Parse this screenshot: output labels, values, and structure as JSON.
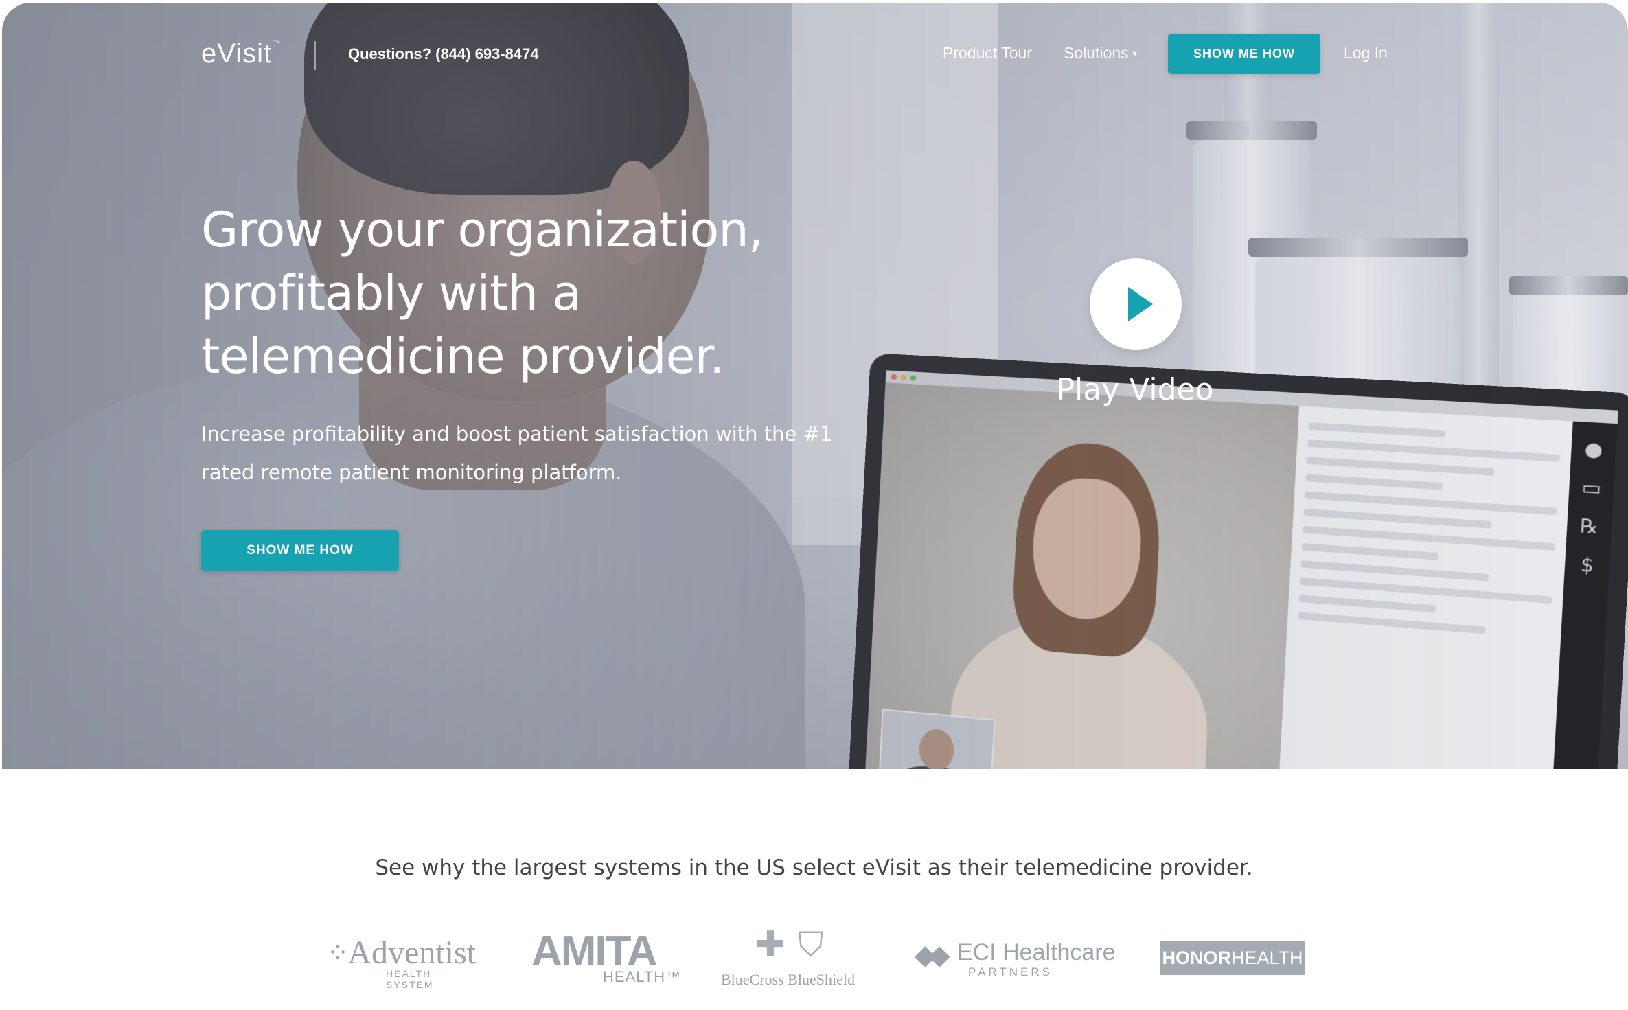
{
  "nav": {
    "logo": "eVisit",
    "logo_tm": "™",
    "phone": "Questions? (844) 693-8474",
    "links": {
      "product_tour": "Product Tour",
      "solutions": "Solutions",
      "login": "Log In"
    },
    "cta": "SHOW ME HOW"
  },
  "hero": {
    "headline": "Grow your organization, profitably with a telemedicine provider.",
    "subhead": "Increase profitability and boost patient satisfaction with the #1 rated remote patient monitoring platform.",
    "cta": "SHOW ME HOW",
    "play_label": "Play Video"
  },
  "clients": {
    "intro": "See why the largest systems in the US select eVisit as their telemedicine provider.",
    "logos": {
      "adventist": {
        "name": "Adventist",
        "tagline": "HEALTH SYSTEM"
      },
      "amita": {
        "name": "AMITA",
        "tagline": "HEALTH™"
      },
      "bcbs": {
        "name": "BlueCross BlueShield"
      },
      "eci": {
        "name": "ECI Healthcare",
        "tagline": "PARTNERS"
      },
      "honor": {
        "bold": "HONOR",
        "rest": "HEALTH"
      }
    }
  },
  "colors": {
    "accent": "#16a2b0",
    "logo_gray": "#9ca3ab"
  },
  "icons": {
    "play": "play-icon",
    "caret": "chevron-down-icon"
  }
}
